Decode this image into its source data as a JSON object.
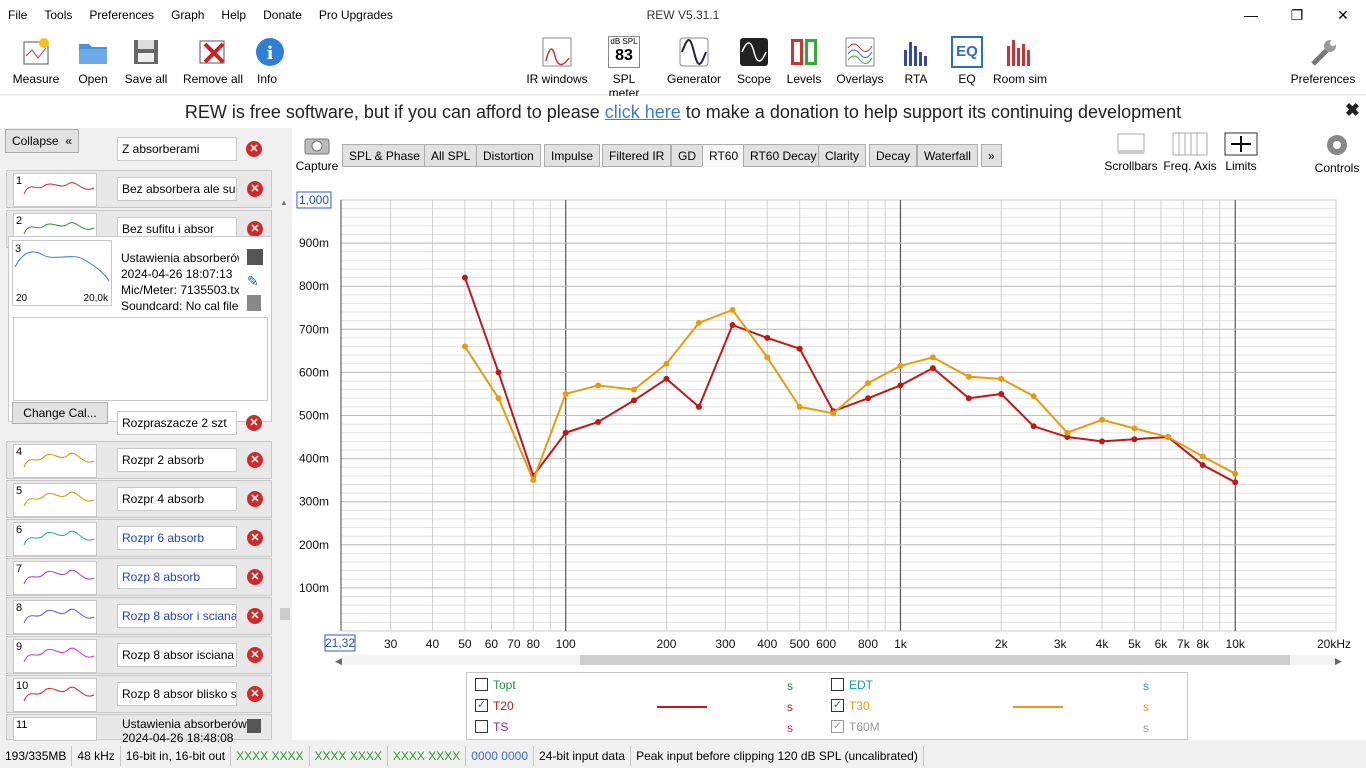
{
  "titlebar": {
    "title": "REW V5.31.1",
    "menu": [
      "File",
      "Tools",
      "Preferences",
      "Graph",
      "Help",
      "Donate",
      "Pro Upgrades"
    ]
  },
  "toolbar": {
    "left": [
      "Measure",
      "Open",
      "Save all",
      "Remove all",
      "Info"
    ],
    "center": [
      "IR windows",
      "SPL meter",
      "Generator",
      "Scope",
      "Levels",
      "Overlays",
      "RTA",
      "EQ",
      "Room sim"
    ],
    "right": "Preferences",
    "spl_icon_top": "dB SPL",
    "spl_icon_value": "83",
    "eq_icon": "EQ"
  },
  "donate": {
    "prefix": "REW is free software, but if you can afford to please ",
    "link": "click here",
    "suffix": " to make a donation to help support its continuing development"
  },
  "leftpanel": {
    "collapse": "Collapse",
    "collapse_icon": "«",
    "top_field": "Z absorberami",
    "rows": [
      {
        "num": "1",
        "name": "Bez absorbera  ale su",
        "color": "#c82828"
      },
      {
        "num": "2",
        "name": "Bez sufitu i absor",
        "color": "#2e8b2e"
      }
    ],
    "selected": {
      "num": "3",
      "name": "Ustawienia absorberów",
      "date": "2024-04-26 18:07:13",
      "mic": "Mic/Meter: 7135503.tx",
      "soundcard": "Soundcard: No cal file",
      "thumb_left": "20",
      "thumb_right": "20,0k"
    },
    "change_cal": "Change Cal...",
    "group_field": "Rozpraszacze 2 szt",
    "rows2": [
      {
        "num": "4",
        "name": "Rozpr 2 absorb",
        "color": "#e08a00",
        "blue": false
      },
      {
        "num": "5",
        "name": "Rozpr 4 absorb",
        "color": "#c9a000",
        "blue": false
      },
      {
        "num": "6",
        "name": "Rozpr 6 absorb",
        "color": "#1fb08a",
        "blue": true
      },
      {
        "num": "7",
        "name": "Rozp 8 absorb",
        "color": "#9a3ad8",
        "blue": true
      },
      {
        "num": "8",
        "name": "Rozp 8 absor i sciana",
        "color": "#5a5ad8",
        "blue": true
      },
      {
        "num": "9",
        "name": "Rozp 8 absor  isciana",
        "color": "#d030c8",
        "blue": false
      },
      {
        "num": "10",
        "name": "Rozp 8 absor blisko s",
        "color": "#c82828",
        "blue": false
      }
    ],
    "row11": {
      "num": "11",
      "name": "Ustawienia absorberów",
      "date": "2024-04-26 18:48:08"
    }
  },
  "tabs": {
    "capture": "Capture",
    "items": [
      "SPL & Phase",
      "All SPL",
      "Distortion",
      "Impulse",
      "Filtered IR",
      "GD",
      "RT60",
      "RT60 Decay",
      "Clarity",
      "Decay",
      "Waterfall",
      "»"
    ],
    "selected": "RT60"
  },
  "graph_controls": [
    "Scrollbars",
    "Freq. Axis",
    "Limits",
    "Controls"
  ],
  "chart_data": {
    "type": "line",
    "ylim": [
      0,
      1.0
    ],
    "yticks": [
      "100m",
      "200m",
      "300m",
      "400m",
      "500m",
      "600m",
      "700m",
      "800m",
      "900m"
    ],
    "ytick_values": [
      0.1,
      0.2,
      0.3,
      0.4,
      0.5,
      0.6,
      0.7,
      0.8,
      0.9
    ],
    "ymax_label": "1,000",
    "xlim": [
      21.32,
      20000
    ],
    "xmin_label": "21,32",
    "xlog": true,
    "xticks": [
      {
        "v": 30,
        "l": "30"
      },
      {
        "v": 40,
        "l": "40"
      },
      {
        "v": 50,
        "l": "50"
      },
      {
        "v": 60,
        "l": "60"
      },
      {
        "v": 70,
        "l": "70"
      },
      {
        "v": 80,
        "l": "80"
      },
      {
        "v": 100,
        "l": "100"
      },
      {
        "v": 200,
        "l": "200"
      },
      {
        "v": 300,
        "l": "300"
      },
      {
        "v": 400,
        "l": "400"
      },
      {
        "v": 500,
        "l": "500"
      },
      {
        "v": 600,
        "l": "600"
      },
      {
        "v": 800,
        "l": "800"
      },
      {
        "v": 1000,
        "l": "1k"
      },
      {
        "v": 2000,
        "l": "2k"
      },
      {
        "v": 3000,
        "l": "3k"
      },
      {
        "v": 4000,
        "l": "4k"
      },
      {
        "v": 5000,
        "l": "5k"
      },
      {
        "v": 6000,
        "l": "6k"
      },
      {
        "v": 7000,
        "l": "7k"
      },
      {
        "v": 8000,
        "l": "8k"
      },
      {
        "v": 10000,
        "l": "10k"
      },
      {
        "v": 20000,
        "l": "20kHz"
      }
    ],
    "x": [
      50,
      63,
      80,
      100,
      125,
      160,
      200,
      250,
      315,
      400,
      500,
      630,
      800,
      1000,
      1250,
      1600,
      2000,
      2500,
      3150,
      4000,
      5000,
      6300,
      8000,
      10000
    ],
    "series": [
      {
        "name": "T20",
        "color": "#c01818",
        "values": [
          0.82,
          0.6,
          0.36,
          0.46,
          0.485,
          0.535,
          0.585,
          0.52,
          0.71,
          0.68,
          0.655,
          0.51,
          0.54,
          0.57,
          0.61,
          0.54,
          0.55,
          0.475,
          0.45,
          0.44,
          0.445,
          0.45,
          0.385,
          0.345
        ]
      },
      {
        "name": "T30",
        "color": "#e89a10",
        "values": [
          0.66,
          0.54,
          0.35,
          0.55,
          0.57,
          0.56,
          0.62,
          0.715,
          0.745,
          0.635,
          0.52,
          0.505,
          0.575,
          0.615,
          0.635,
          0.59,
          0.585,
          0.545,
          0.46,
          0.49,
          0.47,
          0.45,
          0.405,
          0.365
        ]
      }
    ]
  },
  "legend": {
    "items": [
      {
        "name": "Topt",
        "checked": false,
        "unit": "s",
        "color": "#1f8f3f",
        "line": ""
      },
      {
        "name": "T20",
        "checked": true,
        "unit": "s",
        "color": "#c01818",
        "line": "#c01818"
      },
      {
        "name": "TS",
        "checked": false,
        "unit": "s",
        "color": "#a020a0",
        "line": ""
      },
      {
        "name": "EDT",
        "checked": false,
        "unit": "s",
        "color": "#1a9aa8",
        "line": ""
      },
      {
        "name": "T30",
        "checked": true,
        "unit": "s",
        "color": "#e89a10",
        "line": "#e89a10"
      },
      {
        "name": "T60M",
        "checked": true,
        "unit": "s",
        "color": "#999999",
        "line": ""
      }
    ]
  },
  "status": [
    "193/335MB",
    "48 kHz",
    "16-bit in, 16-bit out",
    "XXXX XXXX",
    "XXXX XXXX",
    "XXXX XXXX",
    "0000 0000",
    "24-bit input data",
    "Peak input before clipping 120 dB SPL (uncalibrated)"
  ],
  "status_colors": [
    "#000",
    "#000",
    "#000",
    "#2e9e2e",
    "#2e9e2e",
    "#2e9e2e",
    "#3a6fd0",
    "#000",
    "#000"
  ]
}
